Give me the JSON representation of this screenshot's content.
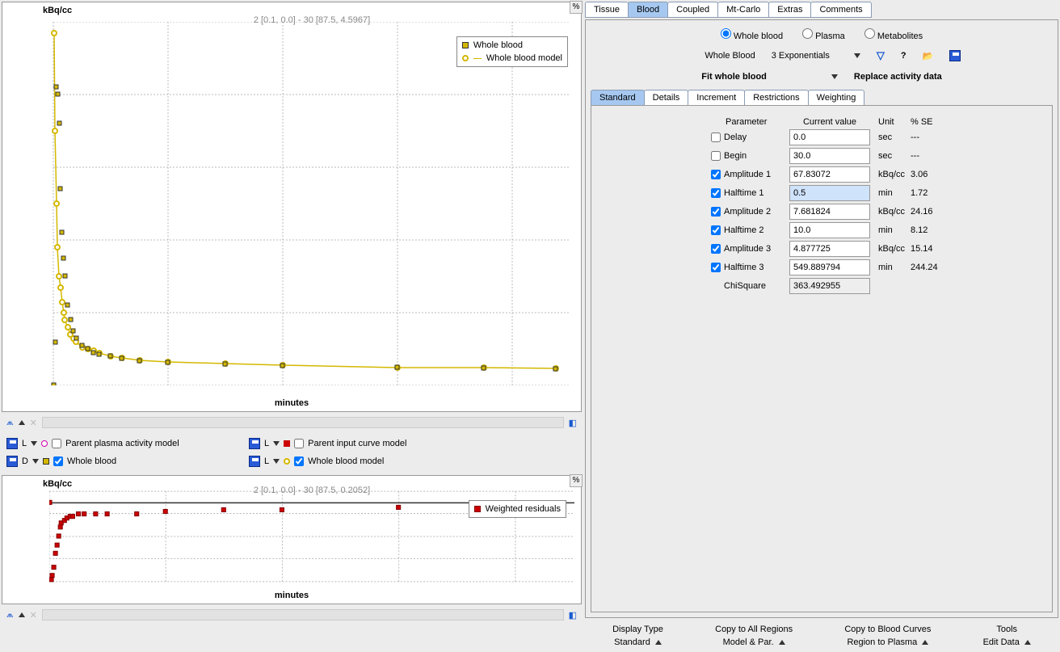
{
  "chart_data": [
    {
      "type": "line",
      "title": "kBq/cc",
      "subtitle": "2 [0.1, 0.0] - 30 [87.5, 4.5967]",
      "xlabel": "minutes",
      "ylabel": "kBq/cc",
      "xlim": [
        0,
        90
      ],
      "ylim": [
        0,
        100
      ],
      "legend": [
        "Whole blood",
        "Whole blood model"
      ],
      "series": [
        {
          "name": "Whole blood",
          "marker": "square-yellow",
          "x": [
            0.1,
            0.3,
            0.5,
            0.7,
            1,
            1.2,
            1.5,
            1.8,
            2,
            2.5,
            3,
            3.5,
            4,
            5,
            6,
            7,
            8,
            10,
            12,
            15,
            20,
            30,
            40,
            60,
            75,
            87.5
          ],
          "y": [
            0,
            12,
            82,
            80,
            72,
            54,
            42,
            35,
            30,
            22,
            18,
            15,
            13,
            11,
            10,
            9,
            8.5,
            8,
            7.5,
            7,
            6.5,
            6,
            5.5,
            5,
            4.8,
            4.6
          ]
        },
        {
          "name": "Whole blood model",
          "marker": "circle-yellow",
          "x": [
            0.1,
            0.3,
            0.5,
            0.7,
            1,
            1.2,
            1.5,
            1.8,
            2,
            2.5,
            3,
            3.5,
            4,
            5,
            6,
            7,
            8,
            10,
            12,
            15,
            20,
            30,
            40,
            60,
            75,
            87.5
          ],
          "y": [
            97,
            70,
            50,
            38,
            30,
            27,
            23,
            20,
            18,
            16,
            14,
            13,
            12,
            10.5,
            10,
            9.5,
            9,
            8,
            7.5,
            7,
            6.5,
            6,
            5.5,
            5,
            4.8,
            4.6
          ]
        }
      ]
    },
    {
      "type": "scatter",
      "title": "kBq/cc",
      "subtitle": "2 [0.1, 0.0] - 30 [87.5, 0.2052]",
      "xlabel": "minutes",
      "ylabel": "kBq/cc",
      "xlim": [
        0,
        90
      ],
      "ylim": [
        -35,
        5
      ],
      "legend": [
        "Weighted residuals"
      ],
      "series": [
        {
          "name": "Weighted residuals",
          "marker": "square-red",
          "x": [
            0.1,
            0.3,
            0.5,
            0.7,
            1,
            1.2,
            1.5,
            1.8,
            2,
            2.5,
            3,
            3.5,
            4,
            5,
            6,
            8,
            10,
            15,
            20,
            30,
            40,
            60,
            87.5
          ],
          "y": [
            0,
            -34,
            -32,
            -28,
            -22,
            -18,
            -14,
            -10,
            -8,
            -7,
            -6,
            -5,
            -5,
            -4,
            -4,
            -4,
            -4,
            -4,
            -3,
            -2,
            -2,
            -1,
            0.2
          ]
        }
      ]
    }
  ],
  "series_panel": {
    "items": [
      {
        "letter": "L",
        "label": "Parent plasma activity model",
        "checked": false
      },
      {
        "letter": "L",
        "label": "Parent input curve model",
        "checked": false
      },
      {
        "letter": "D",
        "label": "Whole blood",
        "checked": true
      },
      {
        "letter": "L",
        "label": "Whole blood model",
        "checked": true
      }
    ]
  },
  "tabs": {
    "main": [
      "Tissue",
      "Blood",
      "Coupled",
      "Mt-Carlo",
      "Extras",
      "Comments"
    ],
    "main_active": "Blood",
    "radios": [
      "Whole blood",
      "Plasma",
      "Metabolites"
    ],
    "radio_selected": "Whole blood",
    "blood_label": "Whole Blood",
    "model_dd": "3 Exponentials",
    "fit_dd": "Fit whole blood",
    "replace_label": "Replace activity data",
    "sub": [
      "Standard",
      "Details",
      "Increment",
      "Restrictions",
      "Weighting"
    ],
    "sub_active": "Standard"
  },
  "params": {
    "headers": {
      "p": "Parameter",
      "v": "Current value",
      "u": "Unit",
      "s": "% SE"
    },
    "rows": [
      {
        "ck": false,
        "name": "Delay",
        "val": "0.0",
        "unit": "sec",
        "se": "---",
        "hl": false
      },
      {
        "ck": false,
        "name": "Begin",
        "val": "30.0",
        "unit": "sec",
        "se": "---",
        "hl": false
      },
      {
        "ck": true,
        "name": "Amplitude 1",
        "val": "67.83072",
        "unit": "kBq/cc",
        "se": "3.06",
        "hl": false
      },
      {
        "ck": true,
        "name": "Halftime 1",
        "val": "0.5",
        "unit": "min",
        "se": "1.72",
        "hl": true
      },
      {
        "ck": true,
        "name": "Amplitude 2",
        "val": "7.681824",
        "unit": "kBq/cc",
        "se": "24.16",
        "hl": false
      },
      {
        "ck": true,
        "name": "Halftime 2",
        "val": "10.0",
        "unit": "min",
        "se": "8.12",
        "hl": false
      },
      {
        "ck": true,
        "name": "Amplitude 3",
        "val": "4.877725",
        "unit": "kBq/cc",
        "se": "15.14",
        "hl": false
      },
      {
        "ck": true,
        "name": "Halftime 3",
        "val": "549.889794",
        "unit": "min",
        "se": "244.24",
        "hl": false
      }
    ],
    "chi_label": "ChiSquare",
    "chi_val": "363.492955"
  },
  "bottom": {
    "cols": [
      {
        "title": "Display Type",
        "val": "Standard"
      },
      {
        "title": "Copy to All Regions",
        "val": "Model & Par."
      },
      {
        "title": "Copy to Blood Curves",
        "val": "Region to Plasma"
      },
      {
        "title": "Tools",
        "val": "Edit Data"
      }
    ]
  },
  "legend1": {
    "a": "Whole blood",
    "b": "Whole blood model"
  },
  "legend2": {
    "a": "Weighted residuals"
  }
}
